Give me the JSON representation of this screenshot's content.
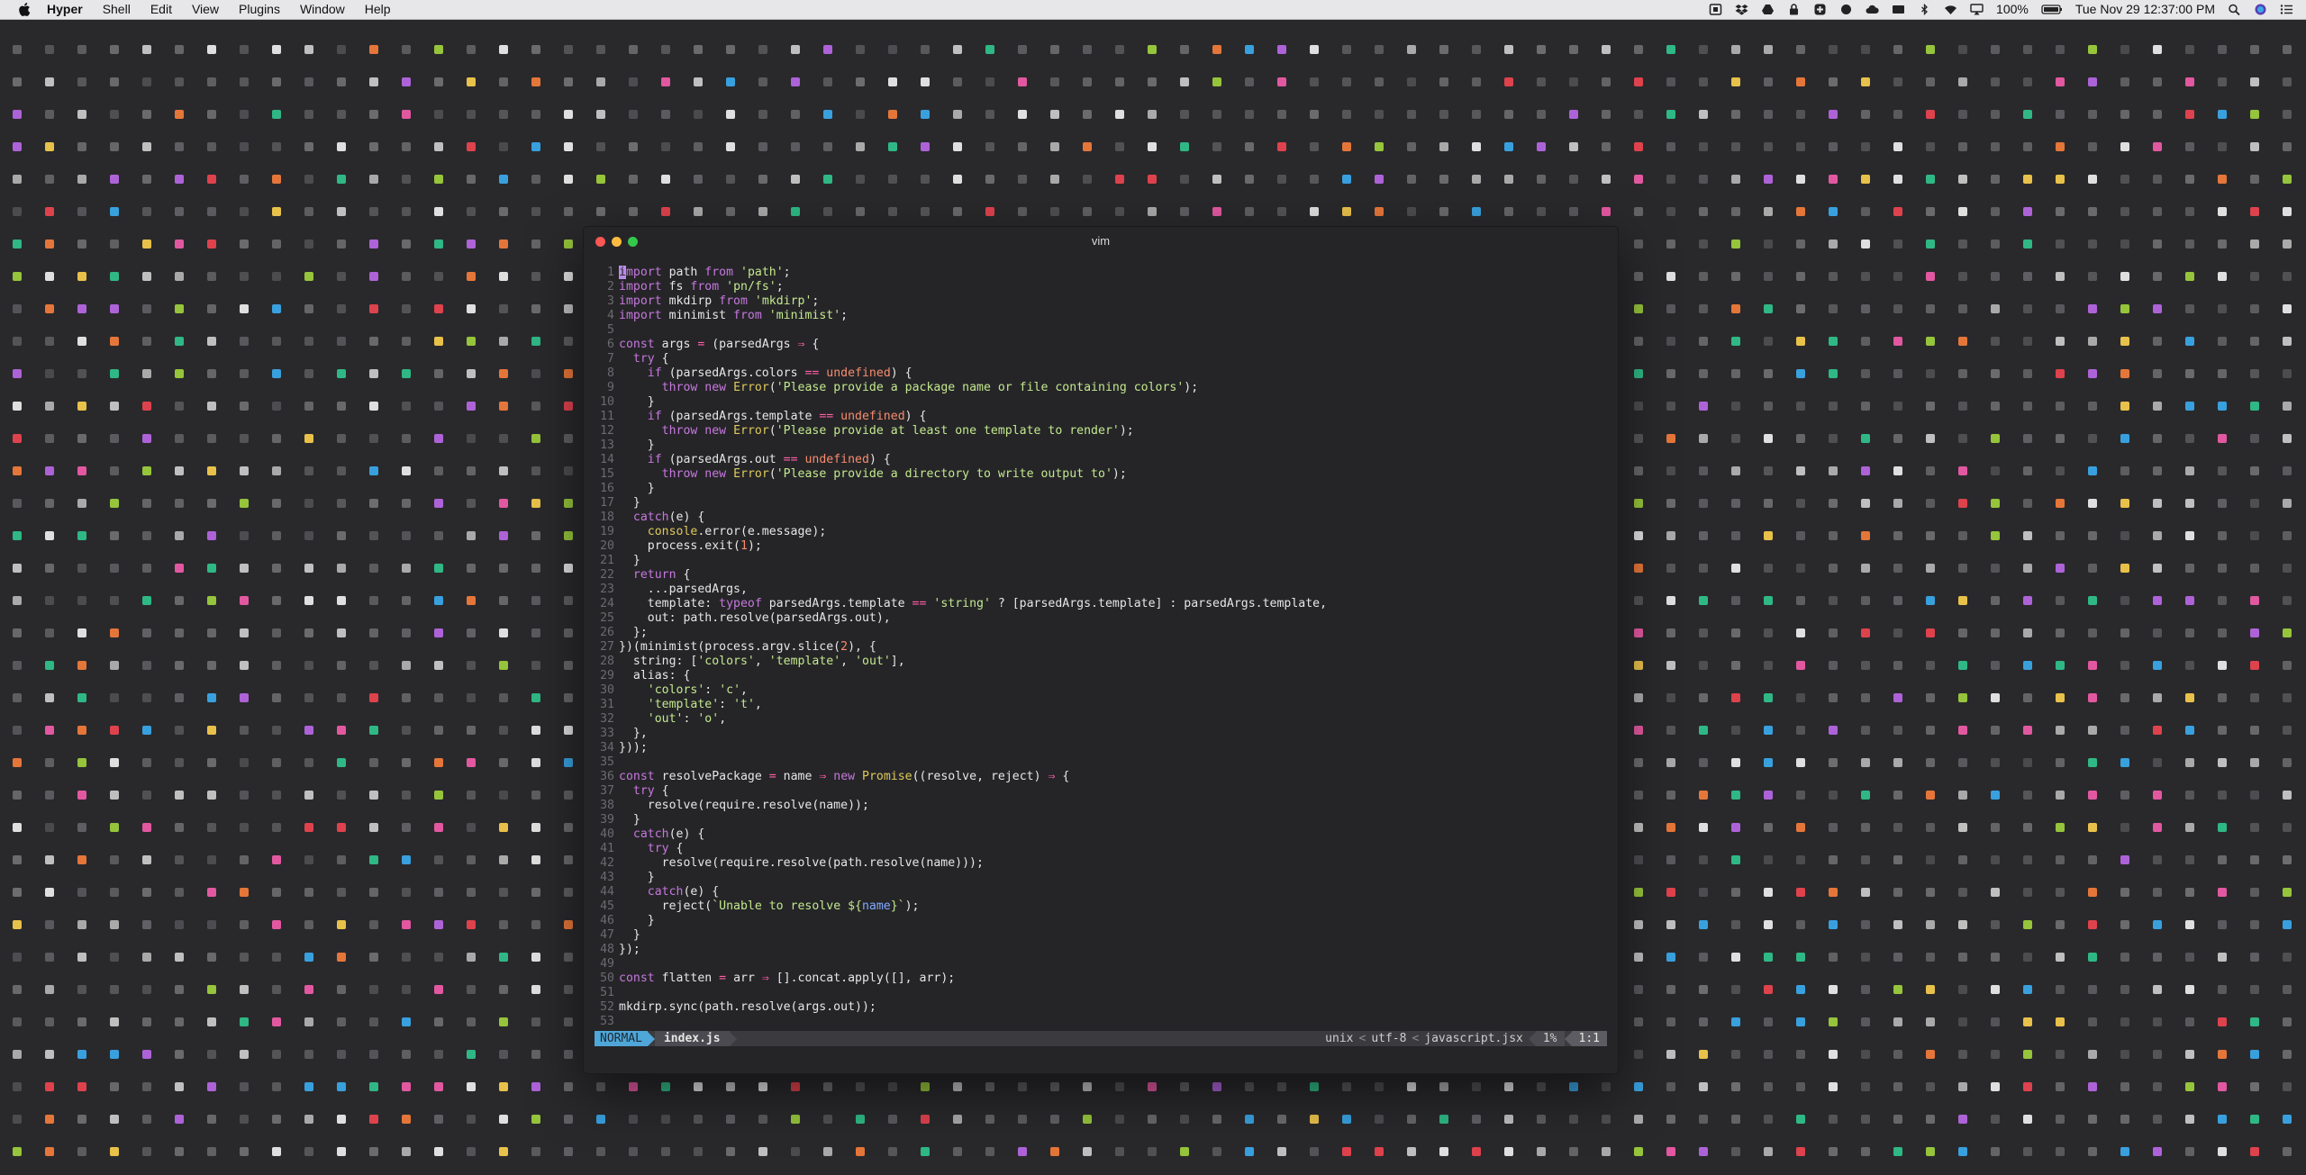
{
  "menubar": {
    "app_name": "Hyper",
    "items": [
      "Shell",
      "Edit",
      "View",
      "Plugins",
      "Window",
      "Help"
    ],
    "battery": "100%",
    "datetime": "Tue Nov 29  12:37:00 PM"
  },
  "window": {
    "title": "vim"
  },
  "editor": {
    "lines": [
      [
        [
          "kw",
          "import"
        ],
        [
          "",
          "path "
        ],
        [
          "kw",
          "from"
        ],
        [
          "",
          " "
        ],
        [
          "str",
          "'path'"
        ],
        [
          "",
          ";"
        ]
      ],
      [
        [
          "kw",
          "import"
        ],
        [
          "",
          "fs "
        ],
        [
          "kw",
          "from"
        ],
        [
          "",
          " "
        ],
        [
          "str",
          "'pn/fs'"
        ],
        [
          "",
          ";"
        ]
      ],
      [
        [
          "kw",
          "import"
        ],
        [
          "",
          "mkdirp "
        ],
        [
          "kw",
          "from"
        ],
        [
          "",
          " "
        ],
        [
          "str",
          "'mkdirp'"
        ],
        [
          "",
          ";"
        ]
      ],
      [
        [
          "kw",
          "import"
        ],
        [
          "",
          "minimist "
        ],
        [
          "kw",
          "from"
        ],
        [
          "",
          " "
        ],
        [
          "str",
          "'minimist'"
        ],
        [
          "",
          ";"
        ]
      ],
      [],
      [
        [
          "kw",
          "const"
        ],
        [
          "",
          " args "
        ],
        [
          "op",
          "="
        ],
        [
          "",
          " (parsedArgs "
        ],
        [
          "op",
          "⇒"
        ],
        [
          "",
          " {"
        ]
      ],
      [
        [
          "",
          "  "
        ],
        [
          "kw",
          "try"
        ],
        [
          "",
          " {"
        ]
      ],
      [
        [
          "",
          "    "
        ],
        [
          "kw",
          "if"
        ],
        [
          "",
          " (parsedArgs.colors "
        ],
        [
          "op",
          "=="
        ],
        [
          "",
          " "
        ],
        [
          "und",
          "undefined"
        ],
        [
          "",
          ") {"
        ]
      ],
      [
        [
          "",
          "      "
        ],
        [
          "kw",
          "throw new"
        ],
        [
          "",
          " "
        ],
        [
          "fn",
          "Error"
        ],
        [
          "",
          "("
        ],
        [
          "str",
          "'Please provide a package name or file containing colors'"
        ],
        [
          "",
          ");"
        ]
      ],
      [
        [
          "",
          "    }"
        ]
      ],
      [
        [
          "",
          "    "
        ],
        [
          "kw",
          "if"
        ],
        [
          "",
          " (parsedArgs.template "
        ],
        [
          "op",
          "=="
        ],
        [
          "",
          " "
        ],
        [
          "und",
          "undefined"
        ],
        [
          "",
          ") {"
        ]
      ],
      [
        [
          "",
          "      "
        ],
        [
          "kw",
          "throw new"
        ],
        [
          "",
          " "
        ],
        [
          "fn",
          "Error"
        ],
        [
          "",
          "("
        ],
        [
          "str",
          "'Please provide at least one template to render'"
        ],
        [
          "",
          ");"
        ]
      ],
      [
        [
          "",
          "    }"
        ]
      ],
      [
        [
          "",
          "    "
        ],
        [
          "kw",
          "if"
        ],
        [
          "",
          " (parsedArgs.out "
        ],
        [
          "op",
          "=="
        ],
        [
          "",
          " "
        ],
        [
          "und",
          "undefined"
        ],
        [
          "",
          ") {"
        ]
      ],
      [
        [
          "",
          "      "
        ],
        [
          "kw",
          "throw new"
        ],
        [
          "",
          " "
        ],
        [
          "fn",
          "Error"
        ],
        [
          "",
          "("
        ],
        [
          "str",
          "'Please provide a directory to write output to'"
        ],
        [
          "",
          ");"
        ]
      ],
      [
        [
          "",
          "    }"
        ]
      ],
      [
        [
          "",
          "  }"
        ]
      ],
      [
        [
          "",
          "  "
        ],
        [
          "kw",
          "catch"
        ],
        [
          "",
          "(e) {"
        ]
      ],
      [
        [
          "",
          "    "
        ],
        [
          "fn",
          "console"
        ],
        [
          "",
          ".error(e.message);"
        ]
      ],
      [
        [
          "",
          "    process.exit("
        ],
        [
          "num",
          "1"
        ],
        [
          "",
          ");"
        ]
      ],
      [
        [
          "",
          "  }"
        ]
      ],
      [
        [
          "",
          "  "
        ],
        [
          "kw",
          "return"
        ],
        [
          "",
          " {"
        ]
      ],
      [
        [
          "",
          "    ...parsedArgs,"
        ]
      ],
      [
        [
          "",
          "    template: "
        ],
        [
          "kw",
          "typeof"
        ],
        [
          "",
          " parsedArgs.template "
        ],
        [
          "op",
          "=="
        ],
        [
          "",
          " "
        ],
        [
          "str",
          "'string'"
        ],
        [
          "",
          " ? [parsedArgs.template] : parsedArgs.template,"
        ]
      ],
      [
        [
          "",
          "    out: path.resolve(parsedArgs.out),"
        ]
      ],
      [
        [
          "",
          "  };"
        ]
      ],
      [
        [
          "",
          "})(minimist(process.argv.slice("
        ],
        [
          "num",
          "2"
        ],
        [
          "",
          "), {"
        ]
      ],
      [
        [
          "",
          "  string: ["
        ],
        [
          "str",
          "'colors'"
        ],
        [
          "",
          ", "
        ],
        [
          "str",
          "'template'"
        ],
        [
          "",
          ", "
        ],
        [
          "str",
          "'out'"
        ],
        [
          "",
          "],"
        ]
      ],
      [
        [
          "",
          "  alias: {"
        ]
      ],
      [
        [
          "",
          "    "
        ],
        [
          "str",
          "'colors'"
        ],
        [
          "",
          ": "
        ],
        [
          "str",
          "'c'"
        ],
        [
          "",
          ","
        ]
      ],
      [
        [
          "",
          "    "
        ],
        [
          "str",
          "'template'"
        ],
        [
          "",
          ": "
        ],
        [
          "str",
          "'t'"
        ],
        [
          "",
          ","
        ]
      ],
      [
        [
          "",
          "    "
        ],
        [
          "str",
          "'out'"
        ],
        [
          "",
          ": "
        ],
        [
          "str",
          "'o'"
        ],
        [
          "",
          ","
        ]
      ],
      [
        [
          "",
          "  },"
        ]
      ],
      [
        [
          "",
          "}));"
        ]
      ],
      [],
      [
        [
          "kw",
          "const"
        ],
        [
          "",
          " resolvePackage "
        ],
        [
          "op",
          "="
        ],
        [
          "",
          " name "
        ],
        [
          "op",
          "⇒"
        ],
        [
          "",
          " "
        ],
        [
          "kw",
          "new"
        ],
        [
          "",
          " "
        ],
        [
          "fn",
          "Promise"
        ],
        [
          "",
          "((resolve, reject) "
        ],
        [
          "op",
          "⇒"
        ],
        [
          "",
          " {"
        ]
      ],
      [
        [
          "",
          "  "
        ],
        [
          "kw",
          "try"
        ],
        [
          "",
          " {"
        ]
      ],
      [
        [
          "",
          "    resolve(require.resolve(name));"
        ]
      ],
      [
        [
          "",
          "  }"
        ]
      ],
      [
        [
          "",
          "  "
        ],
        [
          "kw",
          "catch"
        ],
        [
          "",
          "(e) {"
        ]
      ],
      [
        [
          "",
          "    "
        ],
        [
          "kw",
          "try"
        ],
        [
          "",
          " {"
        ]
      ],
      [
        [
          "",
          "      resolve(require.resolve(path.resolve(name)));"
        ]
      ],
      [
        [
          "",
          "    }"
        ]
      ],
      [
        [
          "",
          "    "
        ],
        [
          "kw",
          "catch"
        ],
        [
          "",
          "(e) {"
        ]
      ],
      [
        [
          "",
          "      reject("
        ],
        [
          "str",
          "`Unable to resolve ${"
        ],
        [
          "tag",
          "name"
        ],
        [
          "str",
          "}`"
        ],
        [
          "",
          ");"
        ]
      ],
      [
        [
          "",
          "    }"
        ]
      ],
      [
        [
          "",
          "  }"
        ]
      ],
      [
        [
          "",
          "});"
        ]
      ],
      [],
      [
        [
          "kw",
          "const"
        ],
        [
          "",
          " flatten "
        ],
        [
          "op",
          "="
        ],
        [
          "",
          " arr "
        ],
        [
          "op",
          "⇒"
        ],
        [
          "",
          " [].concat.apply([], arr);"
        ]
      ],
      [],
      [
        [
          "",
          "mkdirp.sync(path.resolve(args.out));"
        ]
      ],
      []
    ]
  },
  "statusline": {
    "mode": "NORMAL",
    "filename": "index.js",
    "fileformat": "unix",
    "encoding": "utf-8",
    "filetype": "javascript.jsx",
    "percent": "1%",
    "position": "1:1"
  },
  "colors": {
    "dot_palette": [
      "#e8434f",
      "#9ccc3c",
      "#2fc08a",
      "#f2c94c",
      "#ec5ba6",
      "#b466e0",
      "#3aa6e8",
      "#ef7a3a",
      "#ffffff",
      "#d9d9d9",
      "#c0c0c0"
    ]
  }
}
